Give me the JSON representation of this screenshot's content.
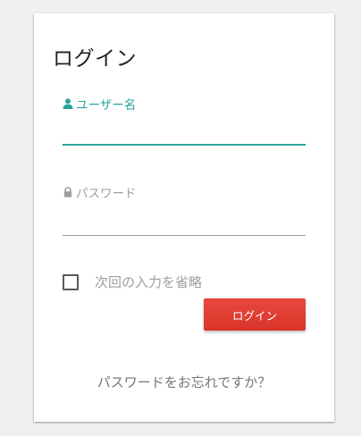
{
  "login": {
    "title": "ログイン",
    "username": {
      "label": "ユーザー名",
      "icon": "person-icon",
      "value": ""
    },
    "password": {
      "label": "パスワード",
      "icon": "lock-icon",
      "value": ""
    },
    "remember_label": "次回の入力を省略",
    "remember_checked": false,
    "submit_label": "ログイン",
    "forgot_label": "パスワードをお忘れですか？"
  },
  "colors": {
    "accent_teal": "#26a69a",
    "button_red": "#df3b31",
    "muted_text": "#9e9e9e"
  }
}
